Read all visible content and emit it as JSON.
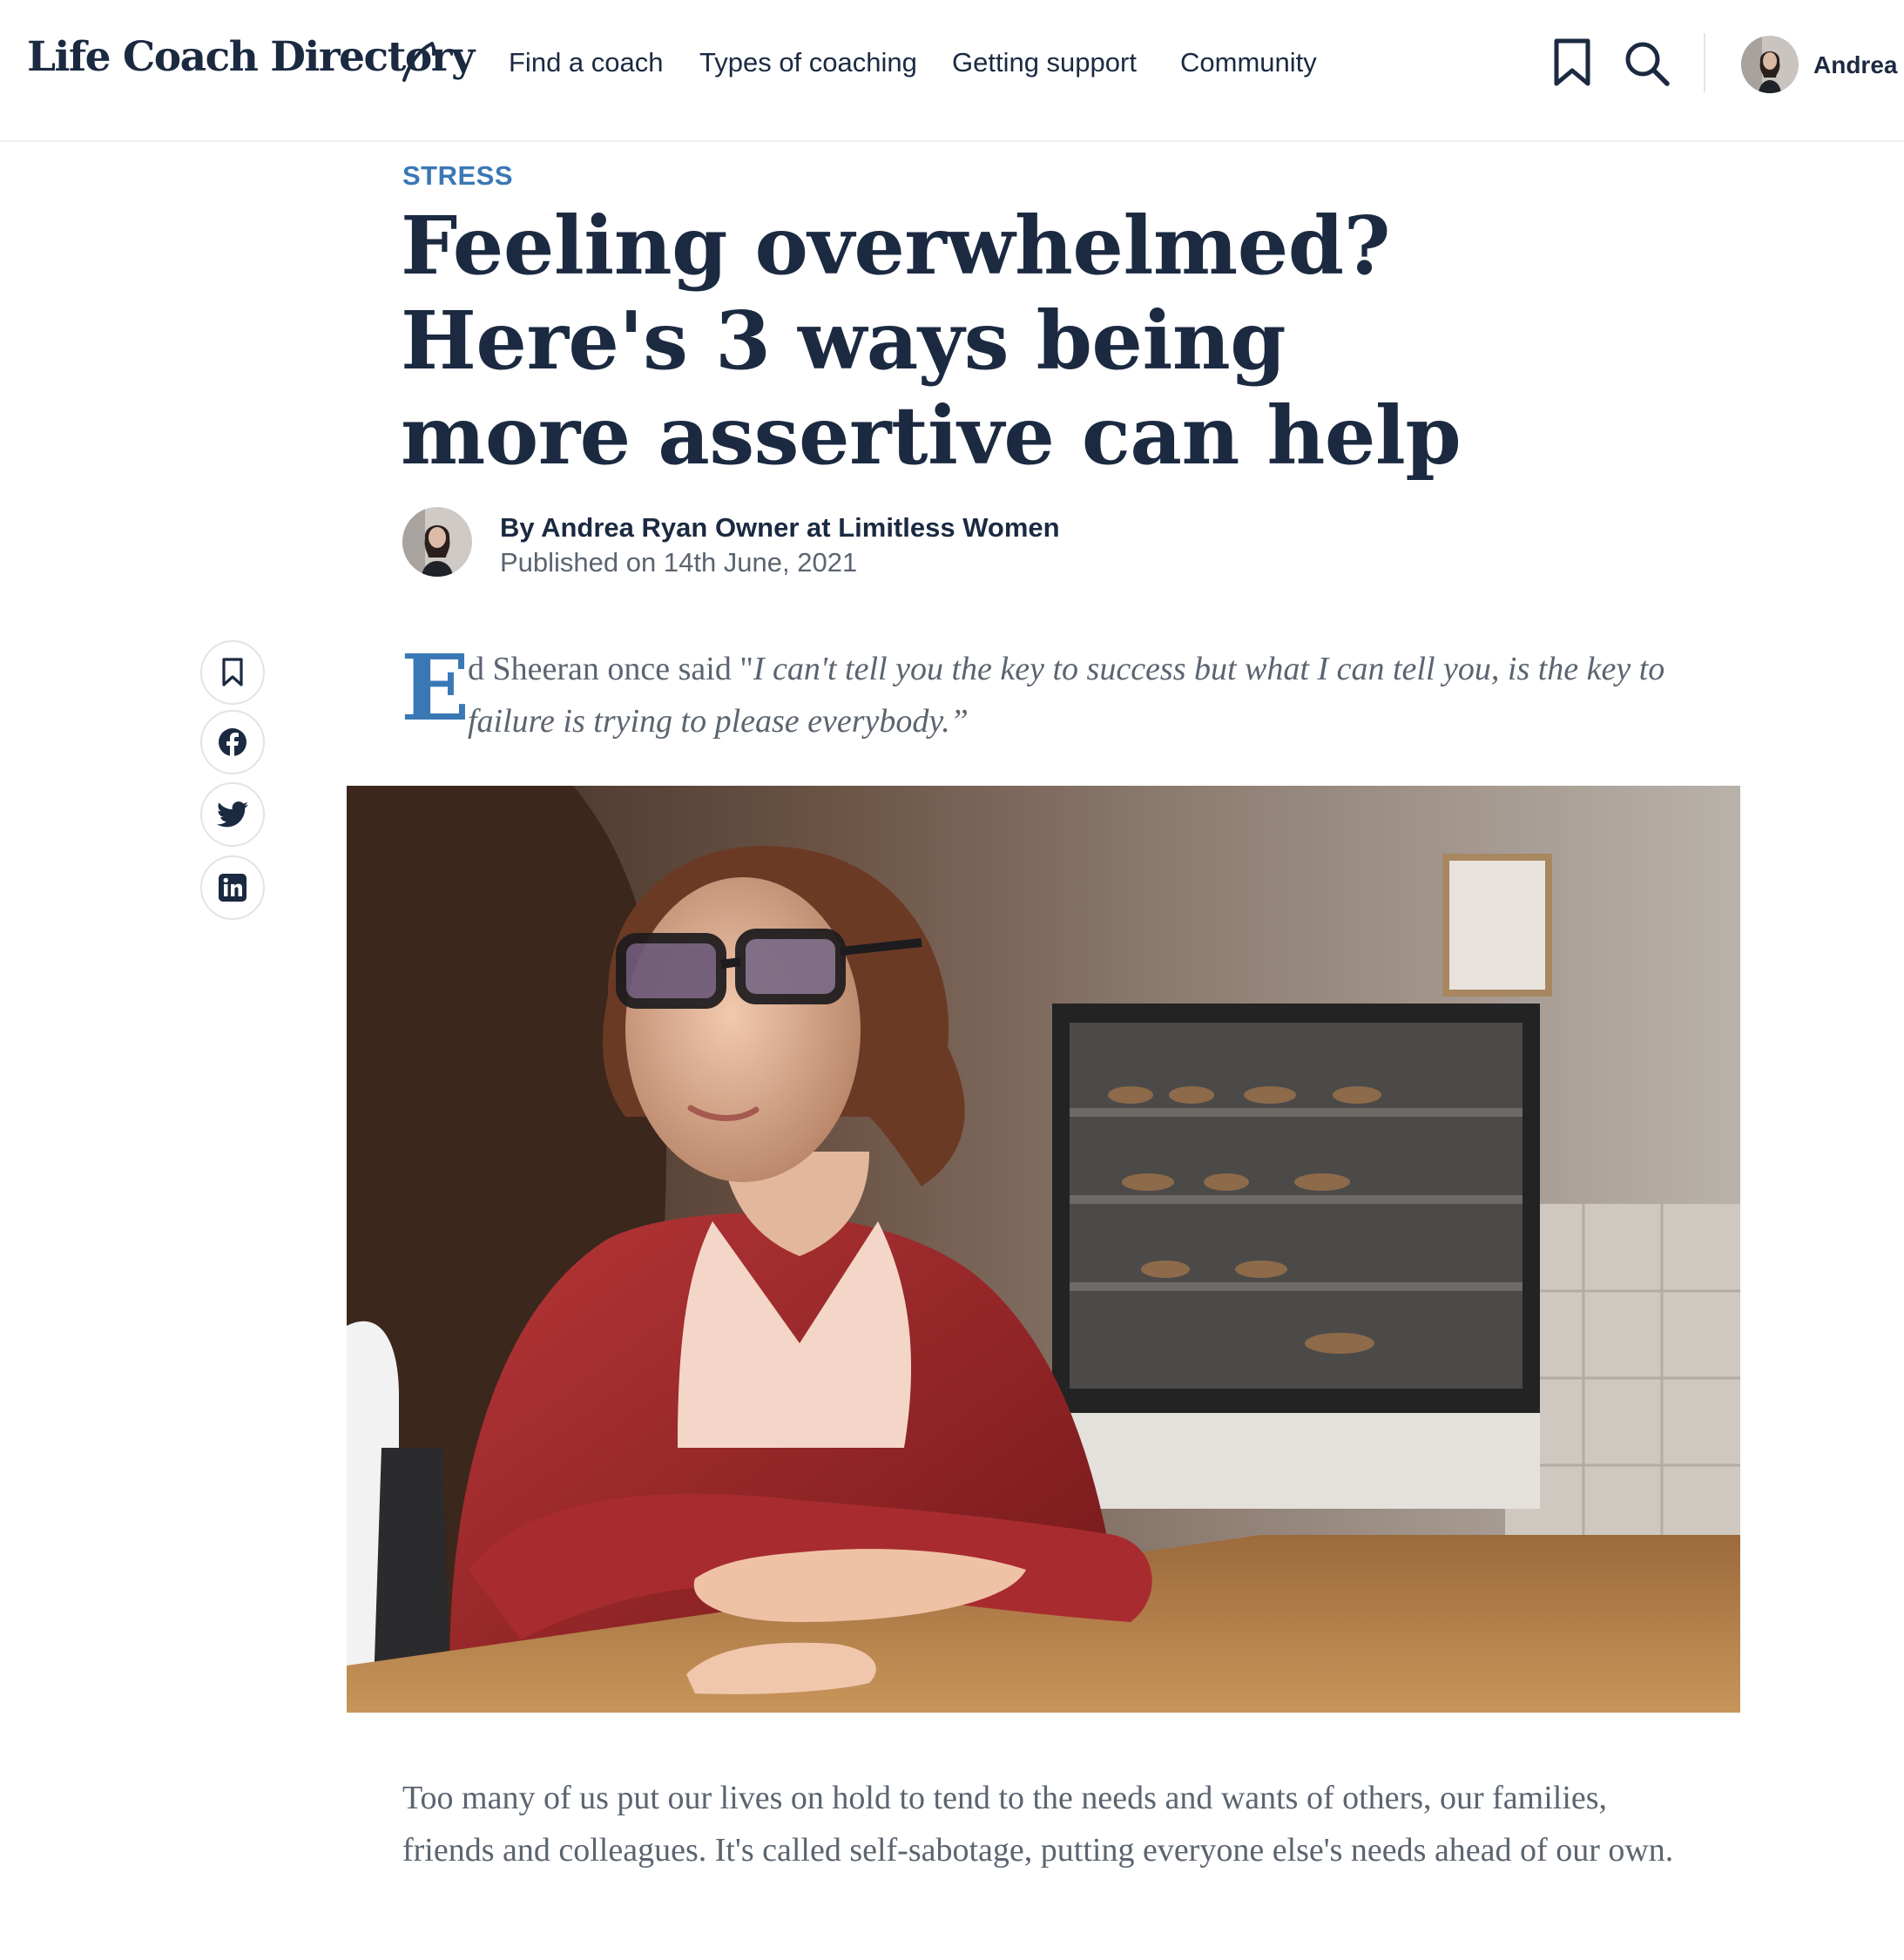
{
  "site": {
    "logo_text": "Life Coach Directory",
    "brand_color": "#1b2a41",
    "accent_color": "#3a78b5"
  },
  "nav": {
    "items": [
      {
        "label": "Find a coach"
      },
      {
        "label": "Types of coaching"
      },
      {
        "label": "Getting support"
      },
      {
        "label": "Community"
      }
    ]
  },
  "header_actions": {
    "bookmark_icon": "bookmark-icon",
    "search_icon": "search-icon",
    "user_name": "Andrea"
  },
  "article": {
    "category": "STRESS",
    "title": "Feeling overwhelmed? Here's 3 ways being more assertive can help",
    "author": {
      "prefix": "By",
      "name": "Andrea Ryan Owner at Limitless Women",
      "published": "Published on 14th June, 2021"
    },
    "intro": {
      "dropcap": "E",
      "lead": "d Sheeran once said \"",
      "quote": "I can't tell you the key to success but what I can tell you, is the key to failure is trying to please everybody.”"
    },
    "body_paragraph": "Too many of us put our lives on hold to tend to the needs and wants of others, our families, friends and colleagues. It's called self-sabotage, putting everyone else's needs ahead of our own."
  },
  "share_rail": [
    {
      "icon": "bookmark-icon"
    },
    {
      "icon": "facebook-icon"
    },
    {
      "icon": "twitter-icon"
    },
    {
      "icon": "linkedin-icon"
    }
  ]
}
